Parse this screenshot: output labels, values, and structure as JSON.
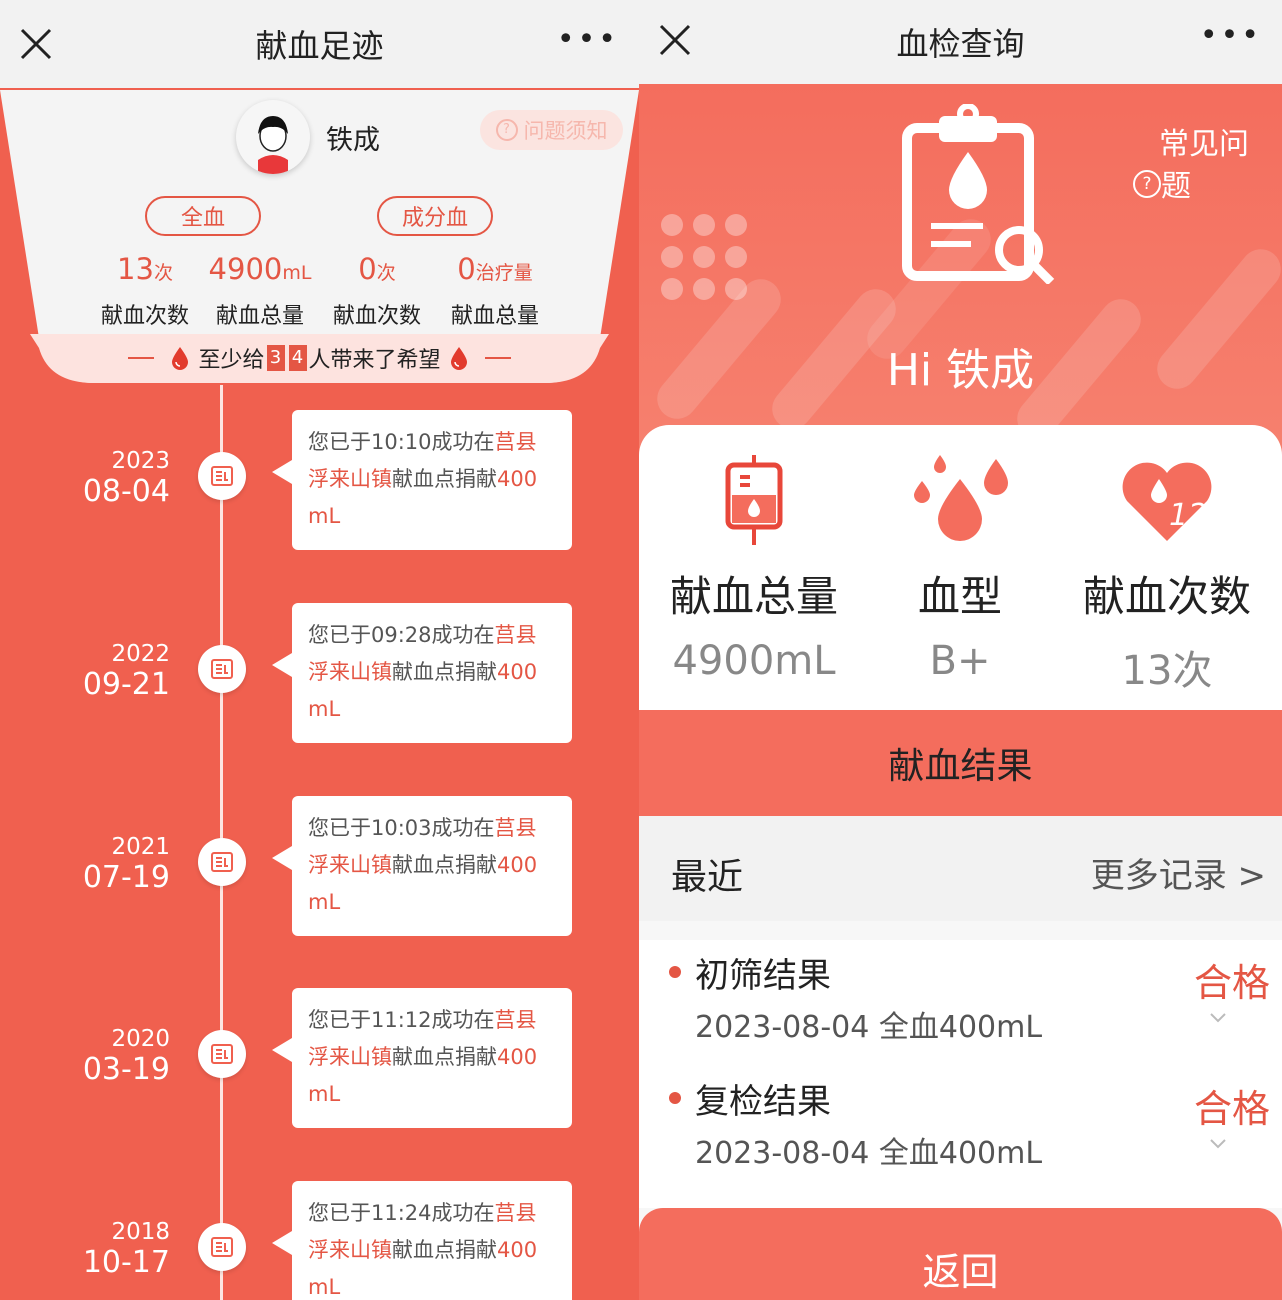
{
  "left": {
    "title": "献血足迹",
    "more": "•••",
    "user": {
      "name": "铁成"
    },
    "help": "问题须知",
    "categories": {
      "whole": "全血",
      "component": "成分血"
    },
    "stats": [
      {
        "num": "13",
        "unit": "次",
        "label": "献血次数"
      },
      {
        "num": "4900",
        "unit": "mL",
        "label": "献血总量"
      },
      {
        "num": "0",
        "unit": "次",
        "label": "献血次数"
      },
      {
        "num": "0",
        "unit": "治疗量",
        "label": "献血总量"
      }
    ],
    "hope": {
      "pre": "至少给",
      "d1": "3",
      "d2": "4",
      "post": "人带来了希望"
    },
    "timeline": [
      {
        "year": "2023",
        "date": "08-04",
        "pre": "您已于10:10成功在",
        "place1": "莒县",
        "place2": "浮来山镇",
        "mid": "献血点捐献",
        "amount": "400",
        "unit": "mL"
      },
      {
        "year": "2022",
        "date": "09-21",
        "pre": "您已于09:28成功在",
        "place1": "莒县",
        "place2": "浮来山镇",
        "mid": "献血点捐献",
        "amount": "400",
        "unit": "mL"
      },
      {
        "year": "2021",
        "date": "07-19",
        "pre": "您已于10:03成功在",
        "place1": "莒县",
        "place2": "浮来山镇",
        "mid": "献血点捐献",
        "amount": "400",
        "unit": "mL"
      },
      {
        "year": "2020",
        "date": "03-19",
        "pre": "您已于11:12成功在",
        "place1": "莒县",
        "place2": "浮来山镇",
        "mid": "献血点捐献",
        "amount": "400",
        "unit": "mL"
      },
      {
        "year": "2018",
        "date": "10-17",
        "pre": "您已于11:24成功在",
        "place1": "莒县",
        "place2": "浮来山镇",
        "mid": "献血点捐献",
        "amount": "400",
        "unit": "mL"
      }
    ]
  },
  "right": {
    "title": "血检查询",
    "more": "•••",
    "faq": "常见问题",
    "faq_line1": "常见问",
    "faq_line2": "题",
    "greeting": "Hi 铁成",
    "stats": [
      {
        "label": "献血总量",
        "value": "4900mL",
        "icon": "blood-bag-icon"
      },
      {
        "label": "血型",
        "value": "B+",
        "icon": "blood-drops-icon"
      },
      {
        "label": "献血次数",
        "value": "13次",
        "icon": "heart-count-icon"
      }
    ],
    "result_header": "献血结果",
    "recent_label": "最近",
    "more_records": "更多记录 >",
    "results": [
      {
        "name": "初筛结果",
        "date": "2023-08-04 全血400mL",
        "status": "合格"
      },
      {
        "name": "复检结果",
        "date": "2023-08-04 全血400mL",
        "status": "合格"
      }
    ],
    "back": "返回"
  },
  "colors": {
    "accent": "#e45644",
    "hero": "#f46d5d",
    "timeline_bg": "#f0604f"
  }
}
